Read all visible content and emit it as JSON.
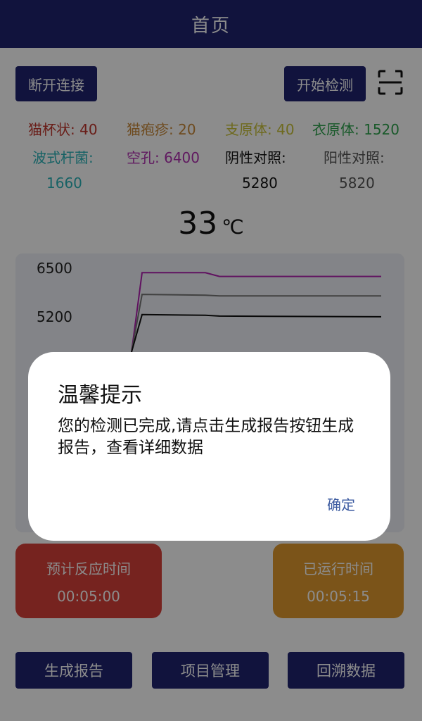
{
  "header": {
    "title": "首页"
  },
  "toolbar": {
    "disconnect_label": "断开连接",
    "start_label": "开始检测",
    "scan_icon": "scan-icon"
  },
  "metrics": [
    {
      "label": "猫杯状: 40",
      "color": "#c0362c"
    },
    {
      "label": "猫疱疹: 20",
      "color": "#c8893a"
    },
    {
      "label": "支原体: 40",
      "color": "#c9c23a"
    },
    {
      "label": "衣原体: 1520",
      "color": "#2fa34d"
    },
    {
      "label": "波式杆菌:",
      "value": "1660",
      "color": "#2ab3b8"
    },
    {
      "label": "空孔: 6400",
      "color": "#b030b0"
    },
    {
      "label": "阴性对照:",
      "value": "5280",
      "color": "#111111"
    },
    {
      "label": "阳性对照:",
      "value": "5820",
      "color": "#555555"
    }
  ],
  "temperature": {
    "value": "33",
    "unit": "℃"
  },
  "chart_data": {
    "type": "line",
    "y_ticks": [
      "6500",
      "5200"
    ],
    "ylim": [
      3900,
      6500
    ],
    "series": [
      {
        "color": "#b020b0",
        "values": [
          1200,
          6400,
          6400,
          6300,
          6300
        ]
      },
      {
        "color": "#777777",
        "values": [
          1200,
          5820,
          5800,
          5780,
          5780
        ]
      },
      {
        "color": "#111111",
        "values": [
          1200,
          5280,
          5260,
          5240,
          5220
        ]
      }
    ]
  },
  "timers": {
    "expected_label": "预计反应时间",
    "expected_value": "00:05:00",
    "elapsed_label": "已运行时间",
    "elapsed_value": "00:05:15"
  },
  "bottom_nav": {
    "report_label": "生成报告",
    "project_label": "项目管理",
    "history_label": "回溯数据"
  },
  "dialog": {
    "title": "温馨提示",
    "message": "您的检测已完成,请点击生成报告按钮生成报告，查看详细数据",
    "ok_label": "确定"
  }
}
